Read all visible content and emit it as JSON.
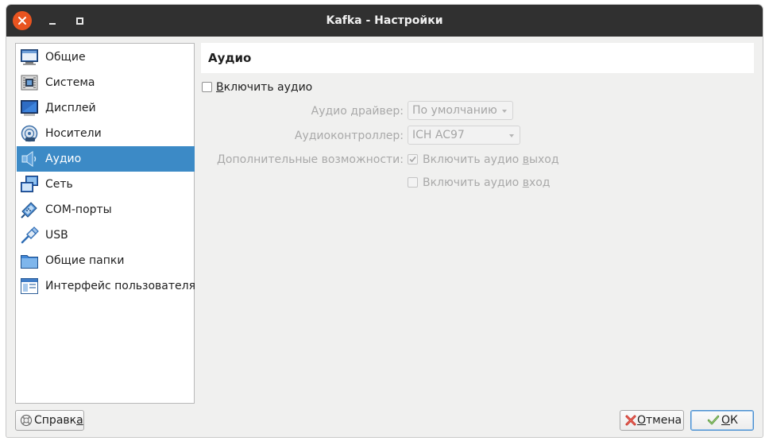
{
  "window": {
    "title": "Kafka - Настройки"
  },
  "sidebar": {
    "items": [
      {
        "label": "Общие",
        "icon": "general-monitor-icon",
        "selected": false
      },
      {
        "label": "Система",
        "icon": "system-chip-icon",
        "selected": false
      },
      {
        "label": "Дисплей",
        "icon": "display-monitor-icon",
        "selected": false
      },
      {
        "label": "Носители",
        "icon": "storage-disc-icon",
        "selected": false
      },
      {
        "label": "Аудио",
        "icon": "audio-speaker-icon",
        "selected": true
      },
      {
        "label": "Сеть",
        "icon": "network-icon",
        "selected": false
      },
      {
        "label": "COM-порты",
        "icon": "serial-port-icon",
        "selected": false
      },
      {
        "label": "USB",
        "icon": "usb-icon",
        "selected": false
      },
      {
        "label": "Общие папки",
        "icon": "shared-folder-icon",
        "selected": false
      },
      {
        "label": "Интерфейс пользователя",
        "icon": "user-interface-icon",
        "selected": false
      }
    ]
  },
  "page": {
    "title": "Аудио",
    "enable_audio": {
      "label_pre": "",
      "label_mnemonic": "В",
      "label_post": "ключить аудио",
      "checked": false
    },
    "driver": {
      "label": "Аудио драйвер:",
      "value": "По умолчанию"
    },
    "controller": {
      "label": "Аудиоконтроллер:",
      "value": "ICH AC97"
    },
    "extended": {
      "label": "Дополнительные возможности:"
    },
    "output": {
      "label_pre": "Включить аудио ",
      "label_mnemonic": "в",
      "label_post": "ыход",
      "checked": true
    },
    "input": {
      "label_pre": "Включить аудио ",
      "label_mnemonic": "в",
      "label_post": "ход",
      "checked": false
    }
  },
  "buttons": {
    "help": {
      "pre": "Справк",
      "mnemonic": "а",
      "post": ""
    },
    "cancel": {
      "pre": "",
      "mnemonic": "О",
      "post": "тмена"
    },
    "ok": {
      "pre": "",
      "mnemonic": "О",
      "post": "К"
    }
  },
  "colors": {
    "titlebar": "#303030",
    "close": "#e95420",
    "selection": "#3c8ac6",
    "background": "#f0f0ef"
  }
}
